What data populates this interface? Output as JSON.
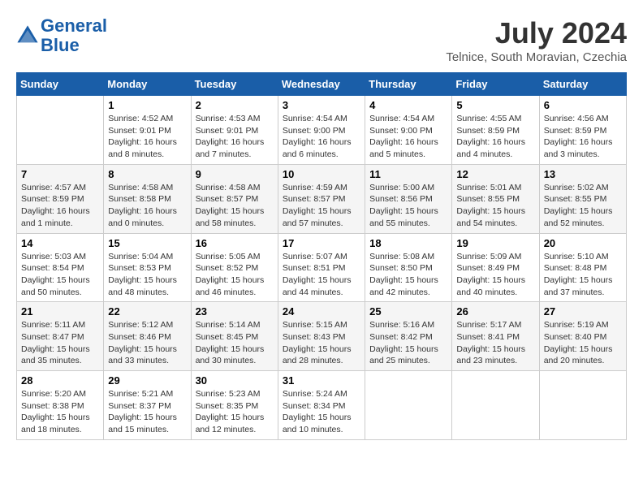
{
  "header": {
    "logo_line1": "General",
    "logo_line2": "Blue",
    "month_year": "July 2024",
    "location": "Telnice, South Moravian, Czechia"
  },
  "weekdays": [
    "Sunday",
    "Monday",
    "Tuesday",
    "Wednesday",
    "Thursday",
    "Friday",
    "Saturday"
  ],
  "weeks": [
    [
      {
        "day": "",
        "info": ""
      },
      {
        "day": "1",
        "info": "Sunrise: 4:52 AM\nSunset: 9:01 PM\nDaylight: 16 hours\nand 8 minutes."
      },
      {
        "day": "2",
        "info": "Sunrise: 4:53 AM\nSunset: 9:01 PM\nDaylight: 16 hours\nand 7 minutes."
      },
      {
        "day": "3",
        "info": "Sunrise: 4:54 AM\nSunset: 9:00 PM\nDaylight: 16 hours\nand 6 minutes."
      },
      {
        "day": "4",
        "info": "Sunrise: 4:54 AM\nSunset: 9:00 PM\nDaylight: 16 hours\nand 5 minutes."
      },
      {
        "day": "5",
        "info": "Sunrise: 4:55 AM\nSunset: 8:59 PM\nDaylight: 16 hours\nand 4 minutes."
      },
      {
        "day": "6",
        "info": "Sunrise: 4:56 AM\nSunset: 8:59 PM\nDaylight: 16 hours\nand 3 minutes."
      }
    ],
    [
      {
        "day": "7",
        "info": "Sunrise: 4:57 AM\nSunset: 8:59 PM\nDaylight: 16 hours\nand 1 minute."
      },
      {
        "day": "8",
        "info": "Sunrise: 4:58 AM\nSunset: 8:58 PM\nDaylight: 16 hours\nand 0 minutes."
      },
      {
        "day": "9",
        "info": "Sunrise: 4:58 AM\nSunset: 8:57 PM\nDaylight: 15 hours\nand 58 minutes."
      },
      {
        "day": "10",
        "info": "Sunrise: 4:59 AM\nSunset: 8:57 PM\nDaylight: 15 hours\nand 57 minutes."
      },
      {
        "day": "11",
        "info": "Sunrise: 5:00 AM\nSunset: 8:56 PM\nDaylight: 15 hours\nand 55 minutes."
      },
      {
        "day": "12",
        "info": "Sunrise: 5:01 AM\nSunset: 8:55 PM\nDaylight: 15 hours\nand 54 minutes."
      },
      {
        "day": "13",
        "info": "Sunrise: 5:02 AM\nSunset: 8:55 PM\nDaylight: 15 hours\nand 52 minutes."
      }
    ],
    [
      {
        "day": "14",
        "info": "Sunrise: 5:03 AM\nSunset: 8:54 PM\nDaylight: 15 hours\nand 50 minutes."
      },
      {
        "day": "15",
        "info": "Sunrise: 5:04 AM\nSunset: 8:53 PM\nDaylight: 15 hours\nand 48 minutes."
      },
      {
        "day": "16",
        "info": "Sunrise: 5:05 AM\nSunset: 8:52 PM\nDaylight: 15 hours\nand 46 minutes."
      },
      {
        "day": "17",
        "info": "Sunrise: 5:07 AM\nSunset: 8:51 PM\nDaylight: 15 hours\nand 44 minutes."
      },
      {
        "day": "18",
        "info": "Sunrise: 5:08 AM\nSunset: 8:50 PM\nDaylight: 15 hours\nand 42 minutes."
      },
      {
        "day": "19",
        "info": "Sunrise: 5:09 AM\nSunset: 8:49 PM\nDaylight: 15 hours\nand 40 minutes."
      },
      {
        "day": "20",
        "info": "Sunrise: 5:10 AM\nSunset: 8:48 PM\nDaylight: 15 hours\nand 37 minutes."
      }
    ],
    [
      {
        "day": "21",
        "info": "Sunrise: 5:11 AM\nSunset: 8:47 PM\nDaylight: 15 hours\nand 35 minutes."
      },
      {
        "day": "22",
        "info": "Sunrise: 5:12 AM\nSunset: 8:46 PM\nDaylight: 15 hours\nand 33 minutes."
      },
      {
        "day": "23",
        "info": "Sunrise: 5:14 AM\nSunset: 8:45 PM\nDaylight: 15 hours\nand 30 minutes."
      },
      {
        "day": "24",
        "info": "Sunrise: 5:15 AM\nSunset: 8:43 PM\nDaylight: 15 hours\nand 28 minutes."
      },
      {
        "day": "25",
        "info": "Sunrise: 5:16 AM\nSunset: 8:42 PM\nDaylight: 15 hours\nand 25 minutes."
      },
      {
        "day": "26",
        "info": "Sunrise: 5:17 AM\nSunset: 8:41 PM\nDaylight: 15 hours\nand 23 minutes."
      },
      {
        "day": "27",
        "info": "Sunrise: 5:19 AM\nSunset: 8:40 PM\nDaylight: 15 hours\nand 20 minutes."
      }
    ],
    [
      {
        "day": "28",
        "info": "Sunrise: 5:20 AM\nSunset: 8:38 PM\nDaylight: 15 hours\nand 18 minutes."
      },
      {
        "day": "29",
        "info": "Sunrise: 5:21 AM\nSunset: 8:37 PM\nDaylight: 15 hours\nand 15 minutes."
      },
      {
        "day": "30",
        "info": "Sunrise: 5:23 AM\nSunset: 8:35 PM\nDaylight: 15 hours\nand 12 minutes."
      },
      {
        "day": "31",
        "info": "Sunrise: 5:24 AM\nSunset: 8:34 PM\nDaylight: 15 hours\nand 10 minutes."
      },
      {
        "day": "",
        "info": ""
      },
      {
        "day": "",
        "info": ""
      },
      {
        "day": "",
        "info": ""
      }
    ]
  ]
}
